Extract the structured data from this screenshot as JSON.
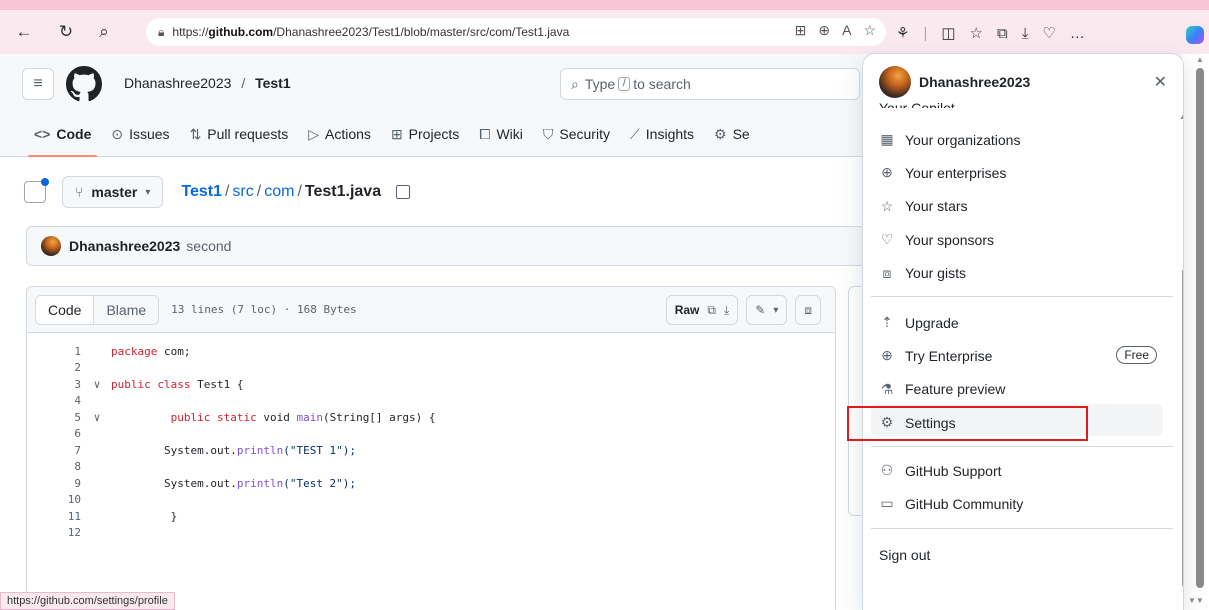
{
  "browser": {
    "url_prefix": "https://",
    "url_host": "github.com",
    "url_path": "/Dhanashree2023/Test1/blob/master/src/com/Test1.java",
    "status_url": "https://github.com/settings/profile"
  },
  "header": {
    "owner": "Dhanashree2023",
    "separator": "/",
    "repo": "Test1",
    "search_prefix": "Type",
    "search_key": "/",
    "search_suffix": "to search"
  },
  "tabs": [
    {
      "label": "Code",
      "icon": "code-icon"
    },
    {
      "label": "Issues",
      "icon": "issue-icon"
    },
    {
      "label": "Pull requests",
      "icon": "pull-request-icon"
    },
    {
      "label": "Actions",
      "icon": "actions-icon"
    },
    {
      "label": "Projects",
      "icon": "projects-icon"
    },
    {
      "label": "Wiki",
      "icon": "wiki-icon"
    },
    {
      "label": "Security",
      "icon": "shield-icon"
    },
    {
      "label": "Insights",
      "icon": "graph-icon"
    },
    {
      "label": "Se",
      "icon": "gear-icon"
    }
  ],
  "file": {
    "branch": "master",
    "path_repo": "Test1",
    "path_dir1": "src",
    "path_dir2": "com",
    "path_file": "Test1.java"
  },
  "commit": {
    "author": "Dhanashree2023",
    "message": "second"
  },
  "code_view": {
    "tab_code": "Code",
    "tab_blame": "Blame",
    "meta": "13 lines (7 loc) · 168 Bytes",
    "raw_label": "Raw",
    "lines": [
      {
        "n": "1",
        "fold": "",
        "indent": "",
        "parts": [
          [
            "kw",
            "package"
          ],
          [
            "",
            "com;"
          ]
        ]
      },
      {
        "n": "2",
        "fold": "",
        "indent": "",
        "parts": []
      },
      {
        "n": "3",
        "fold": "∨",
        "indent": "",
        "parts": [
          [
            "kw",
            "public class"
          ],
          [
            "",
            "Test1 {"
          ]
        ]
      },
      {
        "n": "4",
        "fold": "",
        "indent": "",
        "parts": []
      },
      {
        "n": "5",
        "fold": "∨",
        "indent": "         ",
        "parts": [
          [
            "kw",
            "public static"
          ],
          [
            "",
            "void"
          ],
          [
            "fn",
            "main"
          ],
          [
            "",
            "(String[] args) {"
          ]
        ]
      },
      {
        "n": "6",
        "fold": "",
        "indent": "",
        "parts": []
      },
      {
        "n": "7",
        "fold": "",
        "indent": "        ",
        "parts": [
          [
            "",
            "System.out."
          ],
          [
            "fn",
            "println"
          ],
          [
            "str",
            "(\"TEST 1\");"
          ]
        ]
      },
      {
        "n": "8",
        "fold": "",
        "indent": "",
        "parts": []
      },
      {
        "n": "9",
        "fold": "",
        "indent": "        ",
        "parts": [
          [
            "",
            "System.out."
          ],
          [
            "fn",
            "println"
          ],
          [
            "str",
            "(\"Test 2\");"
          ]
        ]
      },
      {
        "n": "10",
        "fold": "",
        "indent": "",
        "parts": []
      },
      {
        "n": "11",
        "fold": "",
        "indent": "         ",
        "parts": [
          [
            "",
            "}"
          ]
        ]
      },
      {
        "n": "12",
        "fold": "",
        "indent": "",
        "parts": []
      }
    ]
  },
  "menu": {
    "username": "Dhanashree2023",
    "cut_item": "Your Copilot",
    "items_group1": [
      {
        "label": "Your organizations",
        "icon": "organization-icon",
        "glyph": "▦"
      },
      {
        "label": "Your enterprises",
        "icon": "globe-icon",
        "glyph": "⊕"
      },
      {
        "label": "Your stars",
        "icon": "star-icon",
        "glyph": "☆"
      },
      {
        "label": "Your sponsors",
        "icon": "heart-icon",
        "glyph": "♡"
      },
      {
        "label": "Your gists",
        "icon": "code-square-icon",
        "glyph": "⧈"
      }
    ],
    "items_group2": [
      {
        "label": "Upgrade",
        "icon": "upload-icon",
        "glyph": "⇡"
      },
      {
        "label": "Try Enterprise",
        "icon": "globe-icon",
        "glyph": "⊕",
        "badge": "Free"
      },
      {
        "label": "Feature preview",
        "icon": "beaker-icon",
        "glyph": "⚗"
      },
      {
        "label": "Settings",
        "icon": "gear-icon",
        "glyph": "⚙"
      }
    ],
    "items_group3": [
      {
        "label": "GitHub Support",
        "icon": "people-icon",
        "glyph": "⚇"
      },
      {
        "label": "GitHub Community",
        "icon": "comment-icon",
        "glyph": "▭"
      }
    ],
    "sign_out": "Sign out"
  }
}
